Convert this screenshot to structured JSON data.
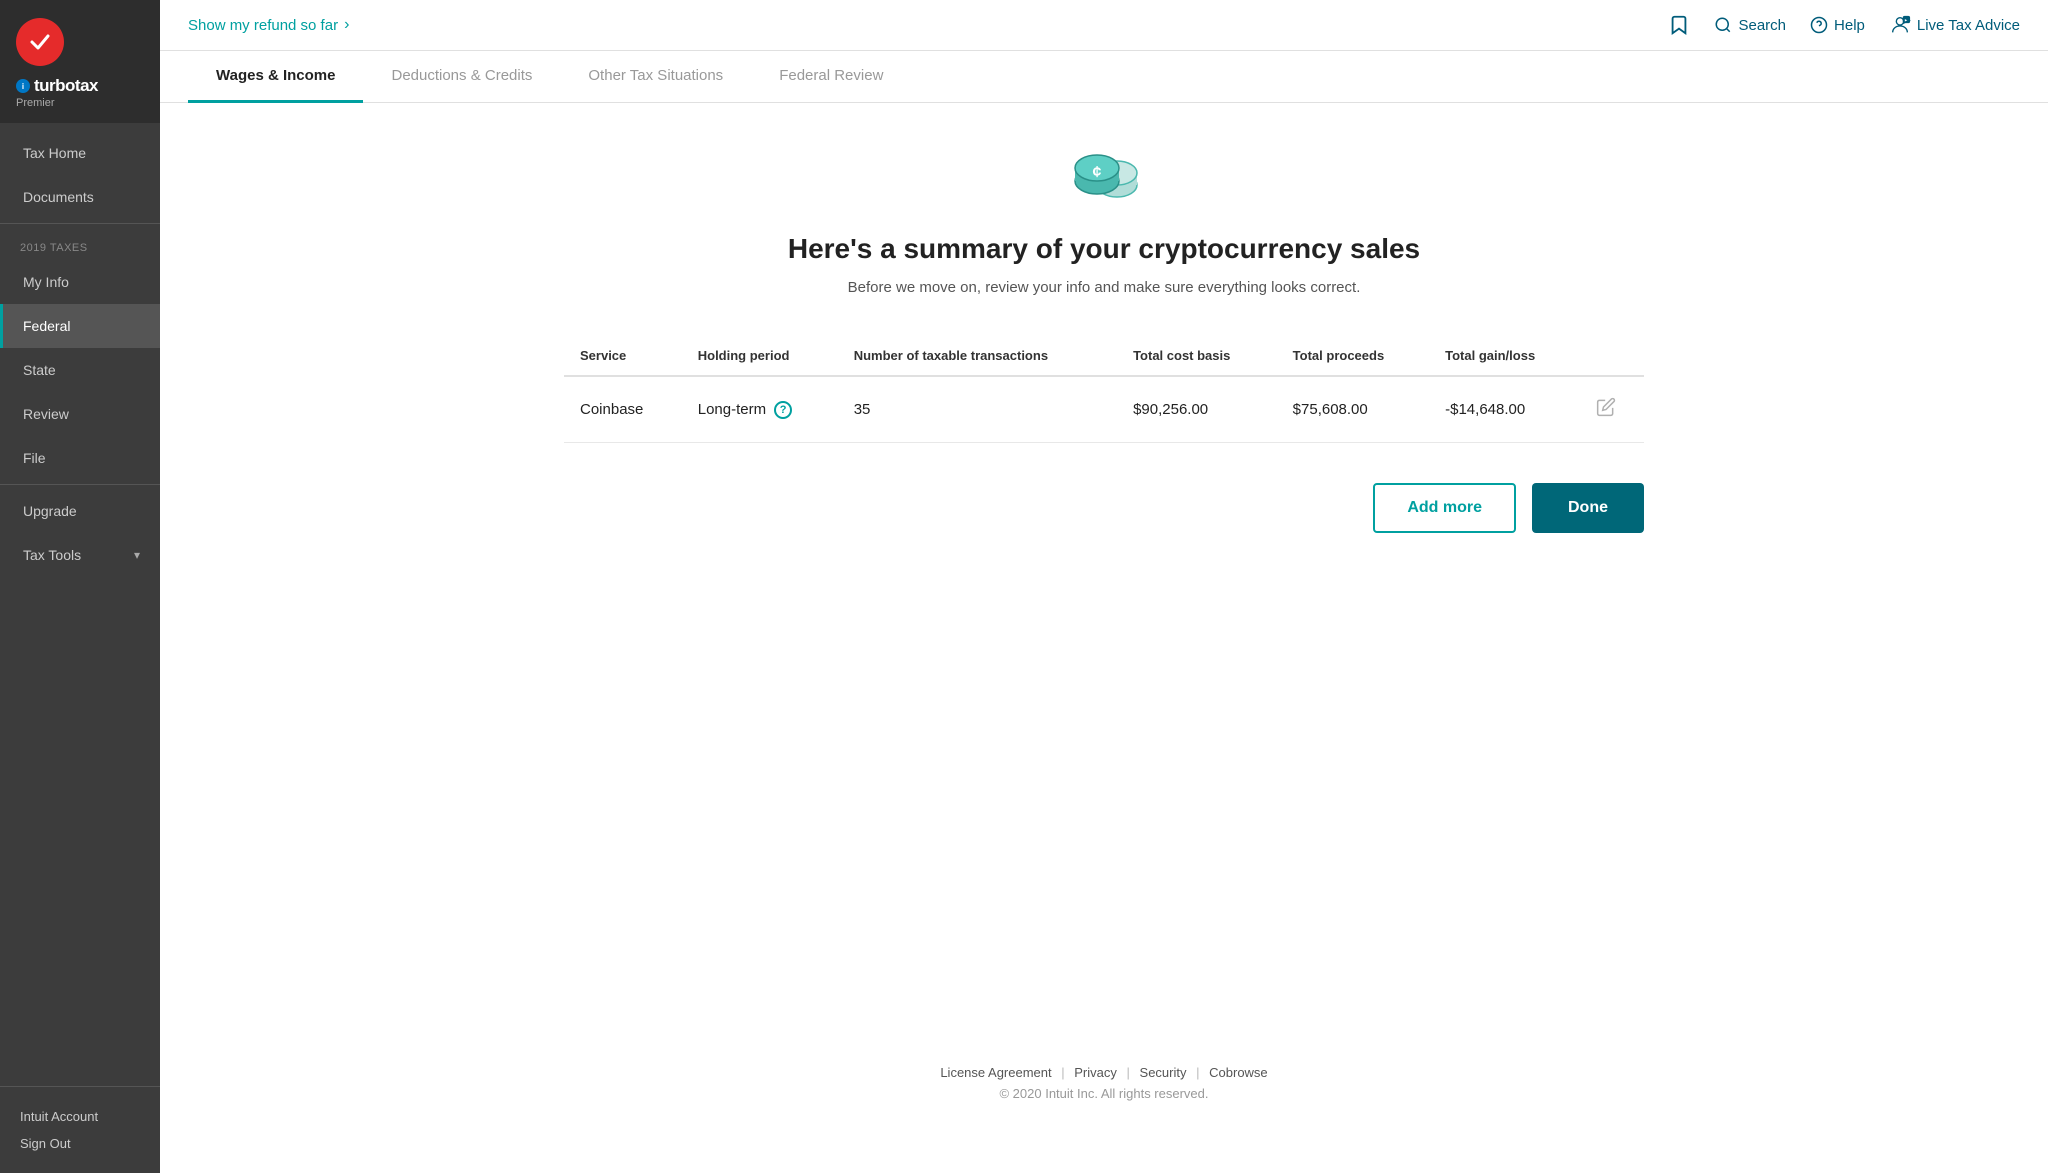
{
  "sidebar": {
    "logo": {
      "brand": "turbotax",
      "tier": "Premier"
    },
    "top_links": [
      {
        "id": "tax-home",
        "label": "Tax Home",
        "active": false
      },
      {
        "id": "documents",
        "label": "Documents",
        "active": false
      }
    ],
    "section_label": "2019 TAXES",
    "nav_items": [
      {
        "id": "my-info",
        "label": "My Info",
        "active": false
      },
      {
        "id": "federal",
        "label": "Federal",
        "active": true
      },
      {
        "id": "state",
        "label": "State",
        "active": false
      },
      {
        "id": "review",
        "label": "Review",
        "active": false
      },
      {
        "id": "file",
        "label": "File",
        "active": false
      }
    ],
    "utility_items": [
      {
        "id": "upgrade",
        "label": "Upgrade"
      },
      {
        "id": "tax-tools",
        "label": "Tax Tools",
        "has_arrow": true
      }
    ],
    "bottom_items": [
      {
        "id": "intuit-account",
        "label": "Intuit Account"
      },
      {
        "id": "sign-out",
        "label": "Sign Out"
      }
    ]
  },
  "topbar": {
    "refund_link": "Show my refund so far",
    "bookmark_tooltip": "Bookmark",
    "search_label": "Search",
    "help_label": "Help",
    "live_tax_label": "Live Tax Advice"
  },
  "tabs": [
    {
      "id": "wages-income",
      "label": "Wages & Income",
      "active": true
    },
    {
      "id": "deductions-credits",
      "label": "Deductions & Credits",
      "active": false
    },
    {
      "id": "other-tax",
      "label": "Other Tax Situations",
      "active": false
    },
    {
      "id": "federal-review",
      "label": "Federal Review",
      "active": false
    }
  ],
  "page": {
    "title": "Here's a summary of your cryptocurrency sales",
    "subtitle": "Before we move on, review your info and make sure everything looks correct."
  },
  "table": {
    "headers": [
      "Service",
      "Holding period",
      "Number of taxable transactions",
      "Total cost basis",
      "Total proceeds",
      "Total gain/loss"
    ],
    "rows": [
      {
        "service": "Coinbase",
        "holding_period": "Long-term",
        "transactions": "35",
        "cost_basis": "$90,256.00",
        "proceeds": "$75,608.00",
        "gain_loss": "-$14,648.00"
      }
    ]
  },
  "buttons": {
    "add_more": "Add more",
    "done": "Done"
  },
  "footer": {
    "links": [
      "License Agreement",
      "Privacy",
      "Security",
      "Cobrowse"
    ],
    "copyright": "© 2020 Intuit Inc. All rights reserved."
  },
  "colors": {
    "teal": "#00a0a0",
    "dark_teal": "#006778",
    "sidebar_bg": "#3c3c3c",
    "active_nav": "#555555"
  }
}
